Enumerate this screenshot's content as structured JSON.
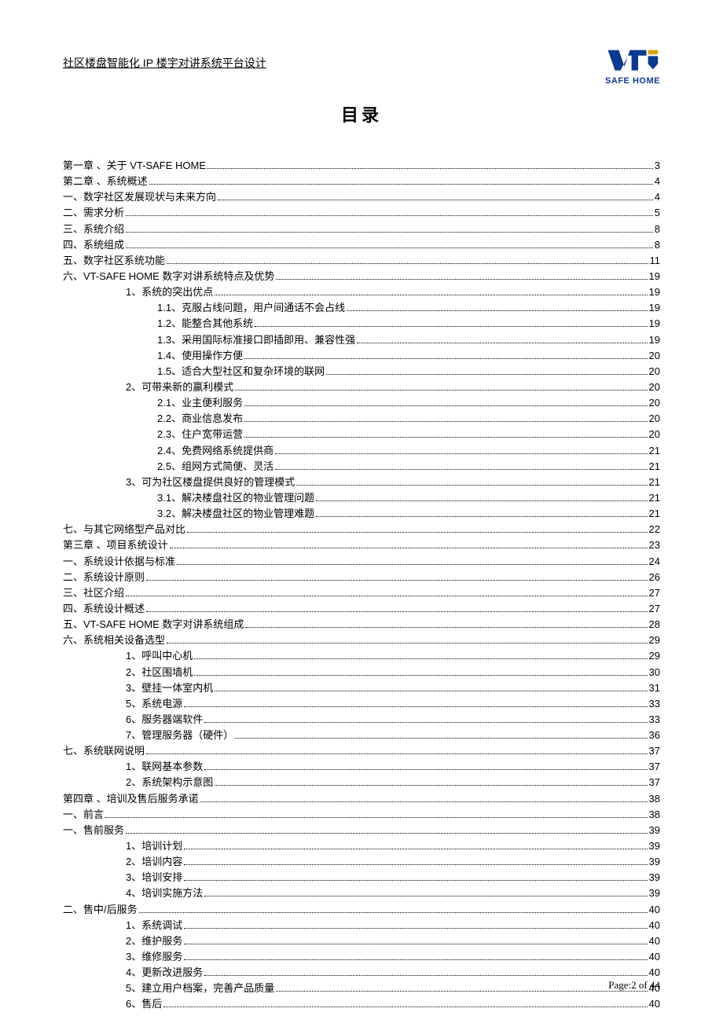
{
  "header": {
    "doc_name": "社区楼盘智能化 IP 楼宇对讲系统平台设计",
    "logo_text": "SAFE HOME"
  },
  "title": "目录",
  "toc": [
    {
      "level": 1,
      "label": "第一章 、关于 VT-SAFE HOME",
      "page": "3"
    },
    {
      "level": 1,
      "label": "第二章 、系统概述",
      "page": "4"
    },
    {
      "level": 1,
      "label": "一、数字社区发展现状与未来方向",
      "page": "4"
    },
    {
      "level": 1,
      "label": "二、需求分析",
      "page": "5"
    },
    {
      "level": 1,
      "label": "三、系统介绍",
      "page": "8"
    },
    {
      "level": 1,
      "label": "四、系统组成",
      "page": "8"
    },
    {
      "level": 1,
      "label": "五、数字社区系统功能",
      "page": "11"
    },
    {
      "level": 1,
      "label": "六、VT-SAFE HOME 数字对讲系统特点及优势",
      "page": "19"
    },
    {
      "level": 2,
      "label": "1、系统的突出优点",
      "page": "19"
    },
    {
      "level": 3,
      "label": "1.1、克服占线问题，用户间通话不会占线",
      "page": "19"
    },
    {
      "level": 3,
      "label": "1.2、能整合其他系统",
      "page": "19"
    },
    {
      "level": 3,
      "label": "1.3、采用国际标准接口即插即用、兼容性强",
      "page": "19"
    },
    {
      "level": 3,
      "label": "1.4、使用操作方便",
      "page": "20"
    },
    {
      "level": 3,
      "label": "1.5、适合大型社区和复杂环境的联网",
      "page": "20"
    },
    {
      "level": 2,
      "label": "2、可带来新的赢利模式",
      "page": "20"
    },
    {
      "level": 3,
      "label": "2.1、业主便利服务",
      "page": "20"
    },
    {
      "level": 3,
      "label": "2.2、商业信息发布",
      "page": "20"
    },
    {
      "level": 3,
      "label": "2.3、住户宽带运营",
      "page": "20"
    },
    {
      "level": 3,
      "label": "2.4、免费网络系统提供商",
      "page": "21"
    },
    {
      "level": 3,
      "label": "2.5、组网方式简便、灵活",
      "page": "21"
    },
    {
      "level": 2,
      "label": "3、可为社区楼盘提供良好的管理模式",
      "page": "21"
    },
    {
      "level": 3,
      "label": "3.1、解决楼盘社区的物业管理问题",
      "page": "21"
    },
    {
      "level": 3,
      "label": "3.2、解决楼盘社区的物业管理难题",
      "page": "21"
    },
    {
      "level": 1,
      "label": "七、与其它网络型产品对比",
      "page": "22"
    },
    {
      "level": 1,
      "label": "第三章 、项目系统设计",
      "page": "23"
    },
    {
      "level": 1,
      "label": "一、系统设计依据与标准",
      "page": "24"
    },
    {
      "level": 1,
      "label": "二、系统设计原则",
      "page": "26"
    },
    {
      "level": 1,
      "label": "三、社区介绍",
      "page": "27"
    },
    {
      "level": 1,
      "label": "四、系统设计概述",
      "page": "27"
    },
    {
      "level": 1,
      "label": "五、VT-SAFE HOME 数字对讲系统组成",
      "page": "28"
    },
    {
      "level": 1,
      "label": "六、系统相关设备选型",
      "page": "29"
    },
    {
      "level": 2,
      "label": "1、呼叫中心机",
      "page": "29"
    },
    {
      "level": 2,
      "label": "2、社区围墙机",
      "page": "30"
    },
    {
      "level": 2,
      "label": "3、壁挂一体室内机",
      "page": "31"
    },
    {
      "level": 2,
      "label": "5、系统电源",
      "page": "33"
    },
    {
      "level": 2,
      "label": "6、服务器端软件",
      "page": "33"
    },
    {
      "level": 2,
      "label": "7、管理服务器（硬件）",
      "page": "36"
    },
    {
      "level": 1,
      "label": "七、系统联网说明",
      "page": "37"
    },
    {
      "level": 2,
      "label": "1、联网基本参数",
      "page": "37"
    },
    {
      "level": 2,
      "label": "2、系统架构示意图",
      "page": "37"
    },
    {
      "level": 1,
      "label": "第四章 、培训及售后服务承诺",
      "page": "38"
    },
    {
      "level": 1,
      "label": "一、前言",
      "page": "38"
    },
    {
      "level": 1,
      "label": "一、售前服务",
      "page": "39"
    },
    {
      "level": 2,
      "label": "1、培训计划",
      "page": "39"
    },
    {
      "level": 2,
      "label": "2、培训内容",
      "page": "39"
    },
    {
      "level": 2,
      "label": "3、培训安排",
      "page": "39"
    },
    {
      "level": 2,
      "label": "4、培训实施方法",
      "page": "39"
    },
    {
      "level": 1,
      "label": "二、售中/后服务",
      "page": "40"
    },
    {
      "level": 2,
      "label": "1、系统调试",
      "page": "40"
    },
    {
      "level": 2,
      "label": "2、维护服务",
      "page": "40"
    },
    {
      "level": 2,
      "label": "3、维修服务",
      "page": "40"
    },
    {
      "level": 2,
      "label": "4、更新改进服务",
      "page": "40"
    },
    {
      "level": 2,
      "label": "5、建立用户档案，完善产品质量",
      "page": "40"
    },
    {
      "level": 2,
      "label": "6、售后",
      "page": "40"
    }
  ],
  "footer": {
    "page_label": "Page:2 of 44"
  }
}
